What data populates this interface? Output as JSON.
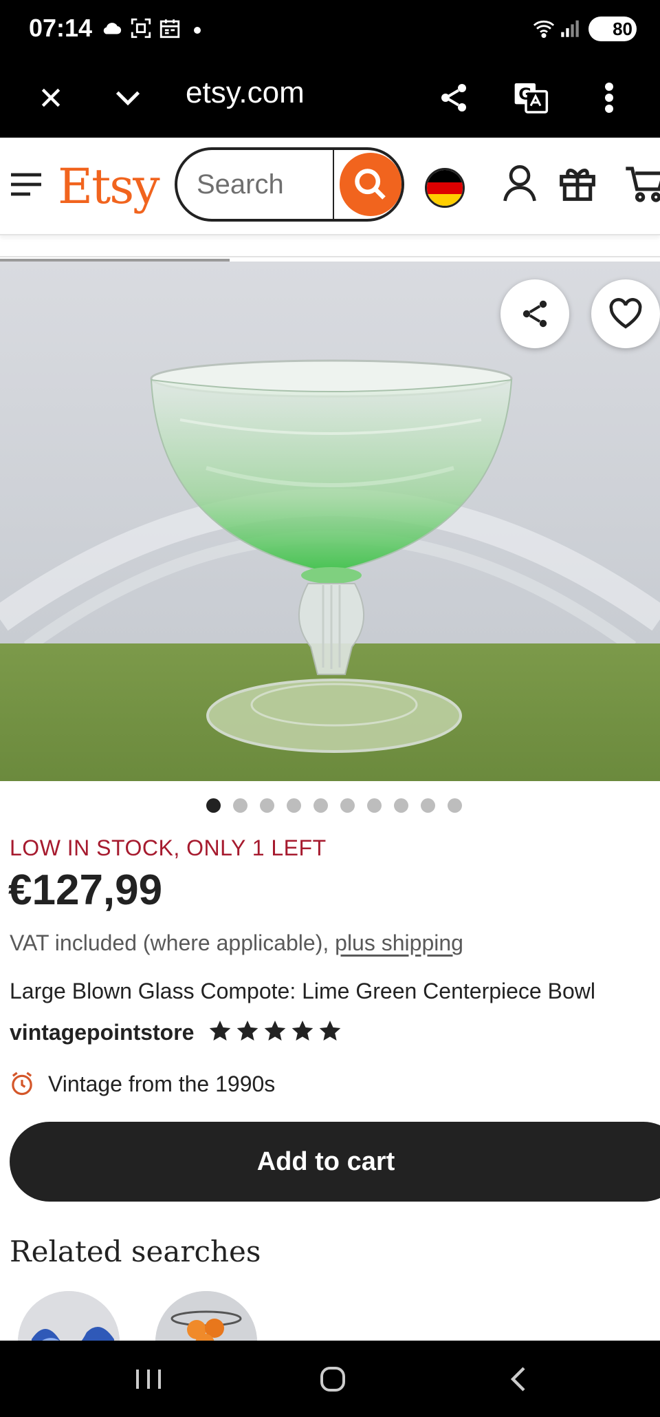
{
  "status_bar": {
    "time": "07:14",
    "battery": "80",
    "icons": [
      "cloud-icon",
      "screenshot-icon",
      "calendar-icon",
      "dot-icon",
      "wifi-icon",
      "signal-icon",
      "battery-icon"
    ]
  },
  "browser": {
    "url": "etsy.com",
    "buttons": [
      "close-icon",
      "chevron-down-icon",
      "share-icon",
      "translate-icon",
      "more-vert-icon"
    ]
  },
  "header": {
    "logo": "Etsy",
    "search_placeholder": "Search",
    "icons": [
      "menu-icon",
      "search-icon",
      "germany-flag-icon",
      "account-icon",
      "gift-icon",
      "cart-icon"
    ]
  },
  "listing": {
    "image_dots": 10,
    "active_dot": 0,
    "stock_notice": "LOW IN STOCK, ONLY 1 LEFT",
    "price": "€127,99",
    "vat_text": "VAT included (where applicable), ",
    "shipping_link": "plus shipping",
    "title": "Large Blown Glass Compote: Lime Green Centerpiece Bowl",
    "shop_name": "vintagepointstore",
    "rating_stars": 5,
    "vintage_label": "Vintage from the 1990s",
    "add_to_cart": "Add to cart"
  },
  "related": {
    "heading": "Related searches"
  },
  "colors": {
    "brand_orange": "#f1641e",
    "stock_red": "#a61a2e",
    "text_dark": "#222222",
    "button_dark": "#222222"
  }
}
